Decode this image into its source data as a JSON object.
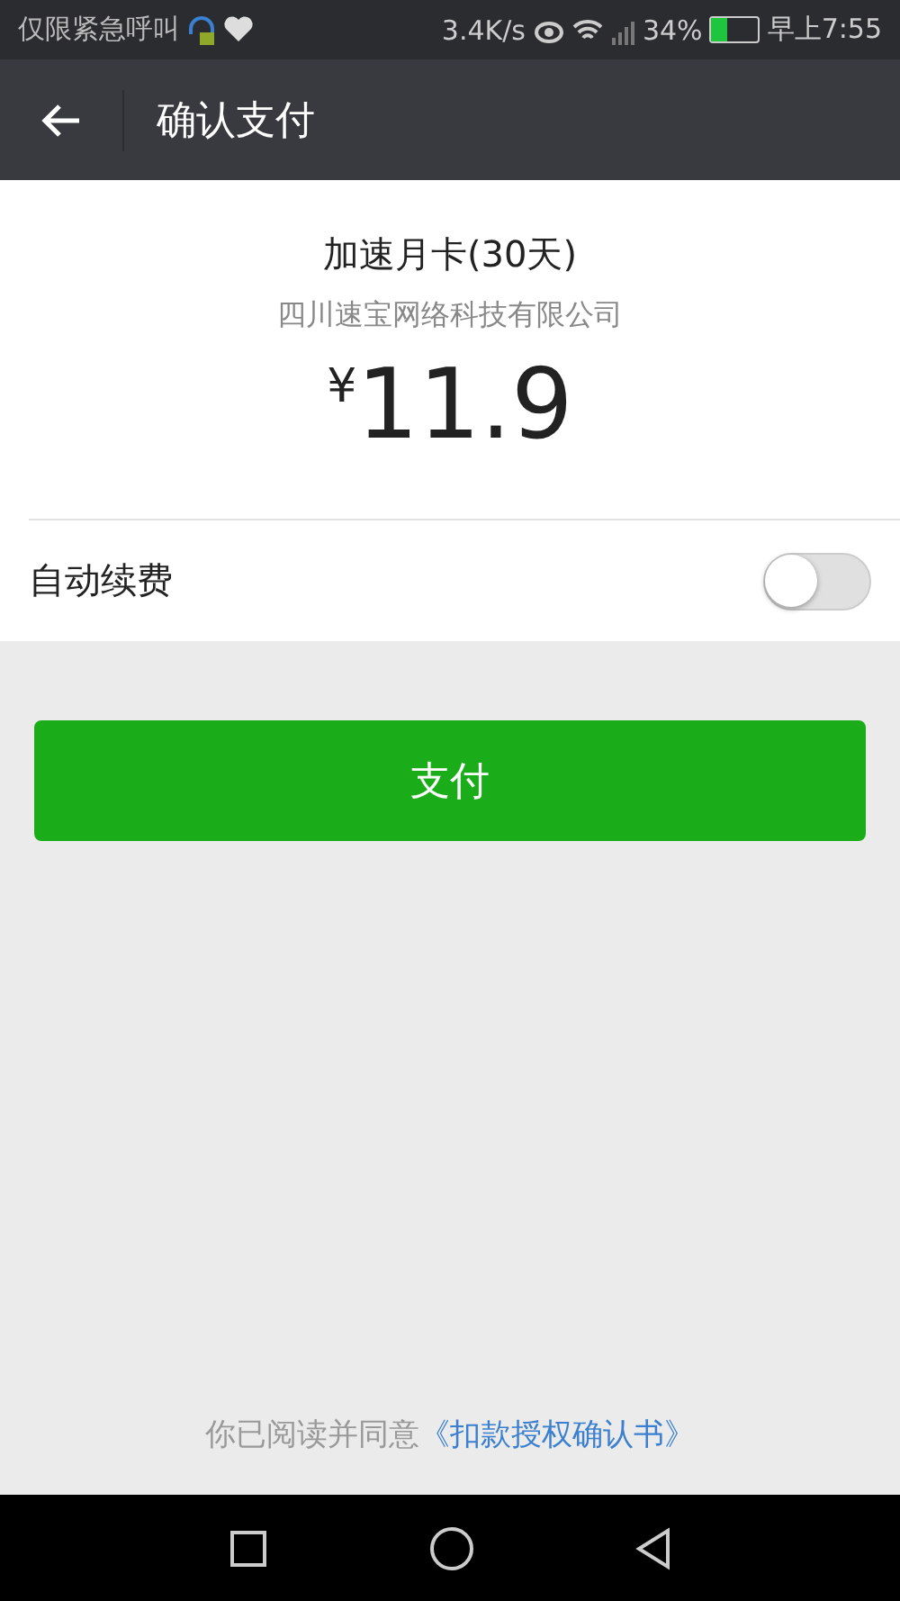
{
  "status_bar": {
    "carrier": "仅限紧急呼叫",
    "speed": "3.4K/s",
    "battery": "34%",
    "time": "早上7:55"
  },
  "header": {
    "title": "确认支付"
  },
  "product": {
    "name": "加速月卡(30天)",
    "merchant": "四川速宝网络科技有限公司",
    "currency": "¥",
    "amount": "11.9"
  },
  "auto_renew": {
    "label": "自动续费",
    "on": false
  },
  "pay_button": "支付",
  "agreement": {
    "text": "你已阅读并同意",
    "link": "《扣款授权确认书》"
  }
}
